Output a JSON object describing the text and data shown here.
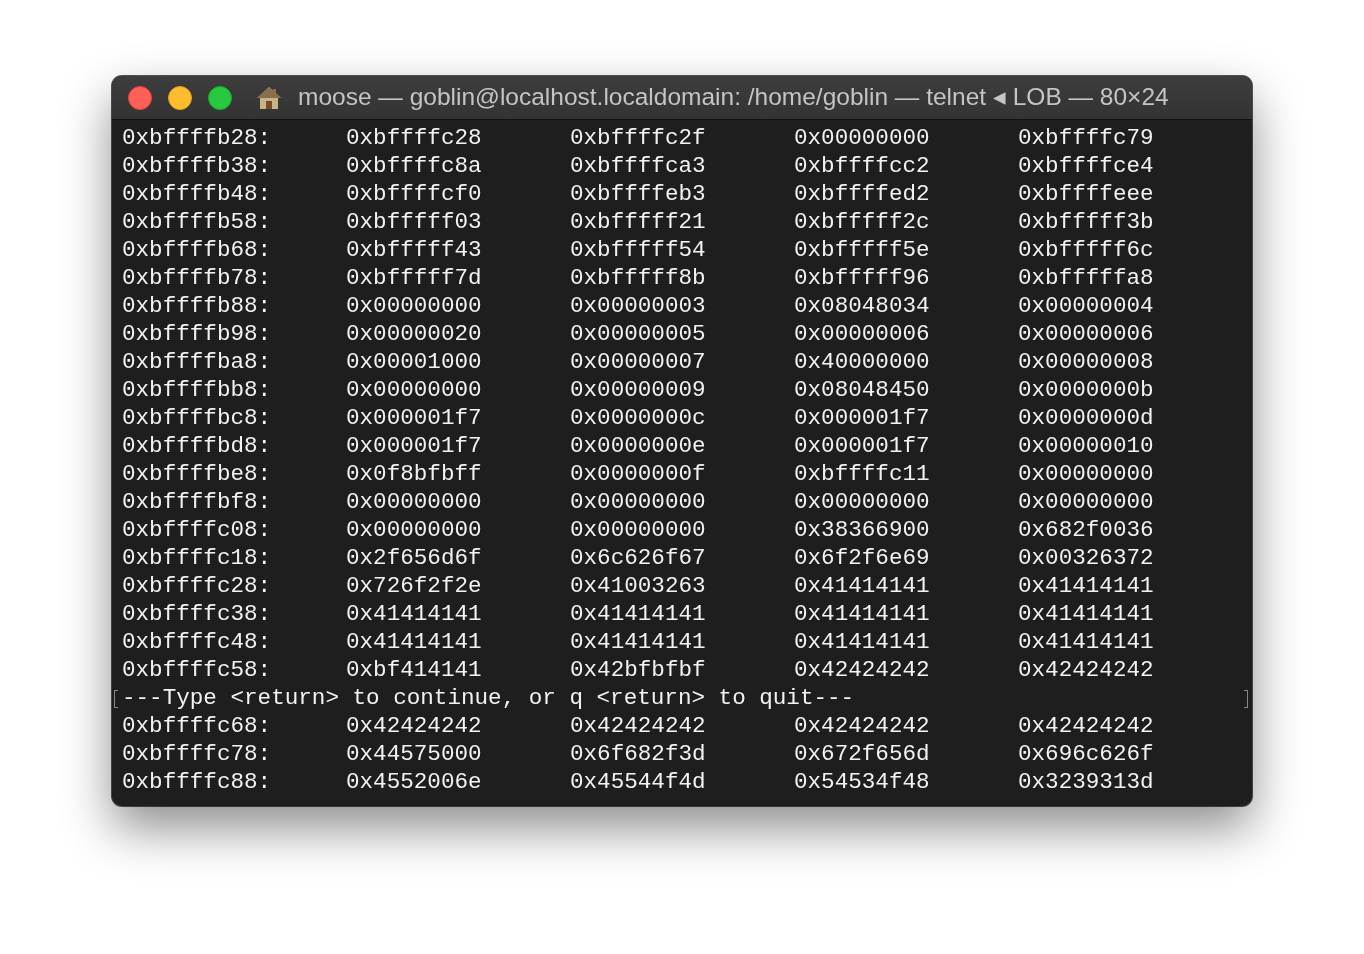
{
  "window": {
    "title": "moose — goblin@localhost.localdomain: /home/goblin — telnet ◂ LOB — 80×24"
  },
  "lines": [
    {
      "kind": "dump",
      "address": "0xbffffb28:",
      "values": [
        "0xbffffc28",
        "0xbffffc2f",
        "0x00000000",
        "0xbffffc79"
      ]
    },
    {
      "kind": "dump",
      "address": "0xbffffb38:",
      "values": [
        "0xbffffc8a",
        "0xbffffca3",
        "0xbffffcc2",
        "0xbffffce4"
      ]
    },
    {
      "kind": "dump",
      "address": "0xbffffb48:",
      "values": [
        "0xbffffcf0",
        "0xbffffeb3",
        "0xbffffed2",
        "0xbffffeee"
      ]
    },
    {
      "kind": "dump",
      "address": "0xbffffb58:",
      "values": [
        "0xbfffff03",
        "0xbfffff21",
        "0xbfffff2c",
        "0xbfffff3b"
      ]
    },
    {
      "kind": "dump",
      "address": "0xbffffb68:",
      "values": [
        "0xbfffff43",
        "0xbfffff54",
        "0xbfffff5e",
        "0xbfffff6c"
      ]
    },
    {
      "kind": "dump",
      "address": "0xbffffb78:",
      "values": [
        "0xbfffff7d",
        "0xbfffff8b",
        "0xbfffff96",
        "0xbfffffa8"
      ]
    },
    {
      "kind": "dump",
      "address": "0xbffffb88:",
      "values": [
        "0x00000000",
        "0x00000003",
        "0x08048034",
        "0x00000004"
      ]
    },
    {
      "kind": "dump",
      "address": "0xbffffb98:",
      "values": [
        "0x00000020",
        "0x00000005",
        "0x00000006",
        "0x00000006"
      ]
    },
    {
      "kind": "dump",
      "address": "0xbffffba8:",
      "values": [
        "0x00001000",
        "0x00000007",
        "0x40000000",
        "0x00000008"
      ]
    },
    {
      "kind": "dump",
      "address": "0xbffffbb8:",
      "values": [
        "0x00000000",
        "0x00000009",
        "0x08048450",
        "0x0000000b"
      ]
    },
    {
      "kind": "dump",
      "address": "0xbffffbc8:",
      "values": [
        "0x000001f7",
        "0x0000000c",
        "0x000001f7",
        "0x0000000d"
      ]
    },
    {
      "kind": "dump",
      "address": "0xbffffbd8:",
      "values": [
        "0x000001f7",
        "0x0000000e",
        "0x000001f7",
        "0x00000010"
      ]
    },
    {
      "kind": "dump",
      "address": "0xbffffbe8:",
      "values": [
        "0x0f8bfbff",
        "0x0000000f",
        "0xbffffc11",
        "0x00000000"
      ]
    },
    {
      "kind": "dump",
      "address": "0xbffffbf8:",
      "values": [
        "0x00000000",
        "0x00000000",
        "0x00000000",
        "0x00000000"
      ]
    },
    {
      "kind": "dump",
      "address": "0xbffffc08:",
      "values": [
        "0x00000000",
        "0x00000000",
        "0x38366900",
        "0x682f0036"
      ]
    },
    {
      "kind": "dump",
      "address": "0xbffffc18:",
      "values": [
        "0x2f656d6f",
        "0x6c626f67",
        "0x6f2f6e69",
        "0x00326372"
      ]
    },
    {
      "kind": "dump",
      "address": "0xbffffc28:",
      "values": [
        "0x726f2f2e",
        "0x41003263",
        "0x41414141",
        "0x41414141"
      ]
    },
    {
      "kind": "dump",
      "address": "0xbffffc38:",
      "values": [
        "0x41414141",
        "0x41414141",
        "0x41414141",
        "0x41414141"
      ]
    },
    {
      "kind": "dump",
      "address": "0xbffffc48:",
      "values": [
        "0x41414141",
        "0x41414141",
        "0x41414141",
        "0x41414141"
      ]
    },
    {
      "kind": "dump",
      "address": "0xbffffc58:",
      "values": [
        "0xbf414141",
        "0x42bfbfbf",
        "0x42424242",
        "0x42424242"
      ]
    },
    {
      "kind": "prompt",
      "text": "---Type <return> to continue, or q <return> to quit---",
      "marked": true
    },
    {
      "kind": "dump",
      "address": "0xbffffc68:",
      "values": [
        "0x42424242",
        "0x42424242",
        "0x42424242",
        "0x42424242"
      ]
    },
    {
      "kind": "dump",
      "address": "0xbffffc78:",
      "values": [
        "0x44575000",
        "0x6f682f3d",
        "0x672f656d",
        "0x696c626f"
      ]
    },
    {
      "kind": "dump",
      "address": "0xbffffc88:",
      "values": [
        "0x4552006e",
        "0x45544f4d",
        "0x54534f48",
        "0x3239313d"
      ]
    }
  ]
}
